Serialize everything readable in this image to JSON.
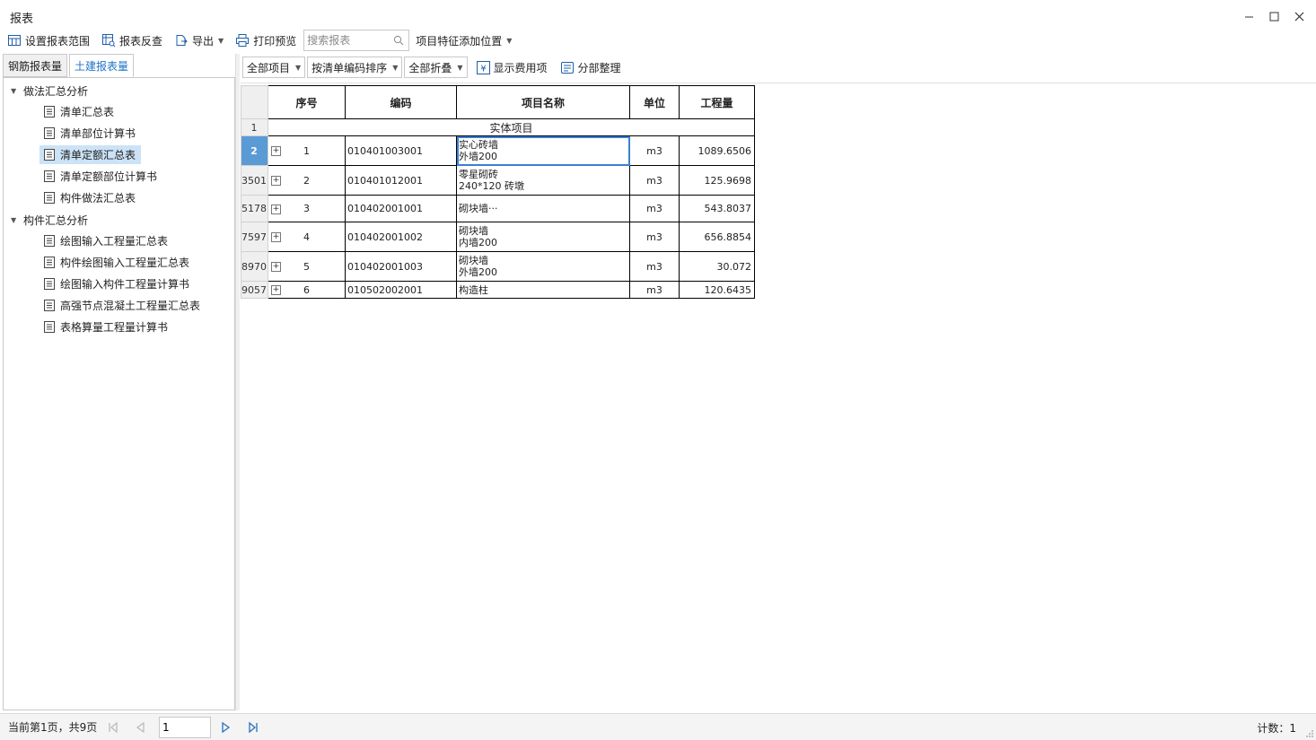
{
  "window": {
    "title": "报表"
  },
  "toolbar": {
    "set_range": "设置报表范围",
    "reverse_check": "报表反查",
    "export": "导出",
    "print_preview": "打印预览",
    "search_placeholder": "搜索报表",
    "feature_position": "项目特征添加位置"
  },
  "left_tabs": [
    "钢筋报表量",
    "土建报表量"
  ],
  "tree": {
    "groups": [
      {
        "label": "做法汇总分析",
        "items": [
          "清单汇总表",
          "清单部位计算书",
          "清单定额汇总表",
          "清单定额部位计算书",
          "构件做法汇总表"
        ]
      },
      {
        "label": "构件汇总分析",
        "items": [
          "绘图输入工程量汇总表",
          "构件绘图输入工程量汇总表",
          "绘图输入构件工程量计算书",
          "高强节点混凝土工程量汇总表",
          "表格算量工程量计算书"
        ]
      }
    ],
    "selected": "清单定额汇总表"
  },
  "report_toolbar": {
    "filter_all": "全部项目",
    "sort": "按清单编码排序",
    "fold": "全部折叠",
    "show_fee": "显示费用项",
    "organize": "分部整理"
  },
  "table": {
    "headers": [
      "序号",
      "编码",
      "项目名称",
      "单位",
      "工程量"
    ],
    "section_row_no": "1",
    "section": "实体项目",
    "rows": [
      {
        "row_no": "2",
        "seq": "1",
        "code": "010401003001",
        "name1": "实心砖墙",
        "name2": "外墙200",
        "unit": "m3",
        "qty": "1089.6506"
      },
      {
        "row_no": "3501",
        "seq": "2",
        "code": "010401012001",
        "name1": "零星砌砖",
        "name2": "240*120 砖墩",
        "unit": "m3",
        "qty": "125.9698"
      },
      {
        "row_no": "5178",
        "seq": "3",
        "code": "010402001001",
        "name1": "砌块墙···",
        "name2": "",
        "unit": "m3",
        "qty": "543.8037"
      },
      {
        "row_no": "7597",
        "seq": "4",
        "code": "010402001002",
        "name1": "砌块墙",
        "name2": "内墙200",
        "unit": "m3",
        "qty": "656.8854"
      },
      {
        "row_no": "8970",
        "seq": "5",
        "code": "010402001003",
        "name1": "砌块墙",
        "name2": "外墙200",
        "unit": "m3",
        "qty": "30.072"
      },
      {
        "row_no": "9057",
        "seq": "6",
        "code": "010502002001",
        "name1": "构造柱",
        "name2": "",
        "unit": "m3",
        "qty": "120.6435"
      }
    ]
  },
  "status": {
    "page_info": "当前第1页，共9页",
    "page_value": "1",
    "count": "计数：1"
  },
  "colors": {
    "accent": "#1f73c9",
    "selected": "#cce2f6",
    "active_row": "#5b9bd5"
  }
}
